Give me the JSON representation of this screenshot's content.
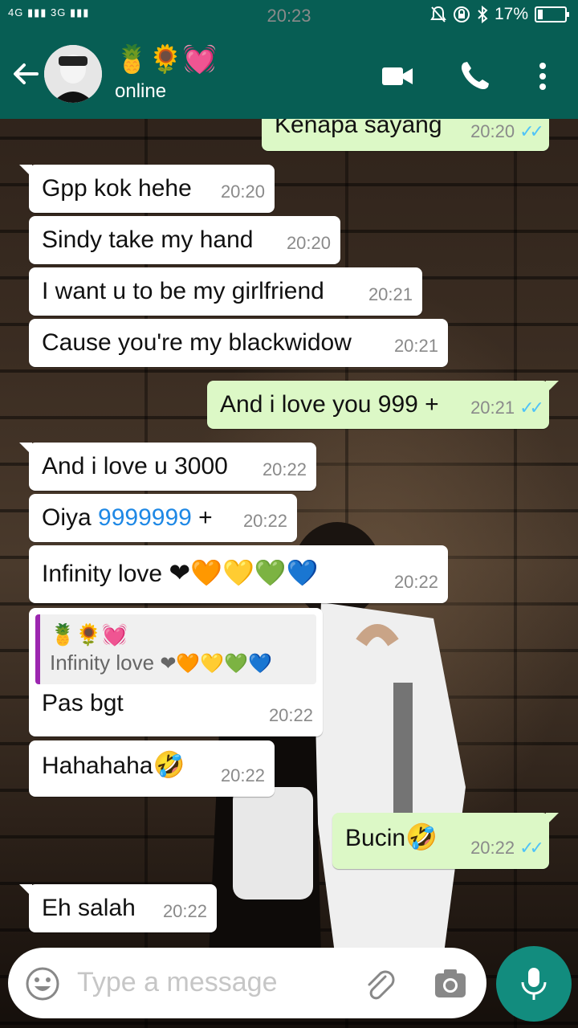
{
  "status_bar": {
    "network": "4G ▮▮▮ 3G ▮▮▮",
    "time": "20:23",
    "battery": "17%"
  },
  "header": {
    "contact_name": "🍍🌻💓",
    "contact_status": "online"
  },
  "messages": [
    {
      "text": "Kenapa sayang",
      "time": "20:20"
    },
    {
      "text": "Gpp kok hehe",
      "time": "20:20"
    },
    {
      "text": "Sindy take my hand",
      "time": "20:20"
    },
    {
      "text": "I want u to be my girlfriend",
      "time": "20:21"
    },
    {
      "text": "Cause you're my blackwidow",
      "time": "20:21"
    },
    {
      "text": "And i love you 999 +",
      "time": "20:21"
    },
    {
      "text": "And i love u 3000",
      "time": "20:22"
    },
    {
      "text_before": "Oiya ",
      "link": "9999999",
      "text_after": " +",
      "time": "20:22"
    },
    {
      "text": "Infinity love",
      "hearts": "❤🧡💛💚💙",
      "time": "20:22"
    },
    {
      "quote_author": "🍍🌻💓",
      "quote_text": "Infinity love",
      "quote_hearts": "❤🧡💛💚💙",
      "text": "Pas bgt",
      "time": "20:22"
    },
    {
      "text": "Hahahaha",
      "emoji": "🤣",
      "time": "20:22"
    },
    {
      "text": "Bucin",
      "emoji": "🤣",
      "time": "20:22"
    },
    {
      "text": "Eh salah",
      "time": "20:22"
    }
  ],
  "input": {
    "placeholder": "Type a message"
  },
  "colors": {
    "header": "#075e54",
    "outgoing_bubble": "#dcf8c6",
    "incoming_bubble": "#ffffff",
    "mic_button": "#128c7e",
    "read_ticks": "#4fc3f7"
  },
  "icons": [
    "back-arrow-icon",
    "video-call-icon",
    "phone-icon",
    "more-vert-icon",
    "emoji-icon",
    "attach-icon",
    "camera-icon",
    "mic-icon"
  ]
}
